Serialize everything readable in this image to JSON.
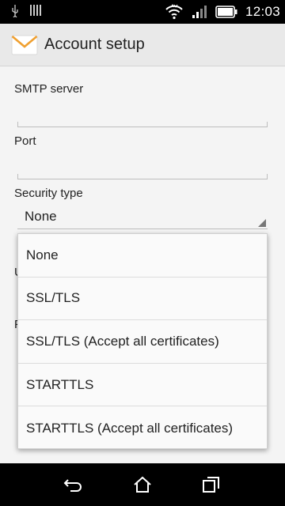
{
  "status_bar": {
    "time": "12:03",
    "icons": [
      "usb-icon",
      "sim-icon",
      "wifi-icon",
      "signal-icon",
      "battery-icon"
    ]
  },
  "action_bar": {
    "icon": "email-envelope-icon",
    "title": "Account setup"
  },
  "form": {
    "smtp_label": "SMTP server",
    "smtp_value": "",
    "port_label": "Port",
    "port_value": "",
    "security_label": "Security type",
    "security_value": "None",
    "hidden_label_1_peek": "U",
    "hidden_label_2_peek": "P"
  },
  "dropdown": {
    "options": [
      "None",
      "SSL/TLS",
      "SSL/TLS (Accept all certificates)",
      "STARTTLS",
      "STARTTLS (Accept all certificates)"
    ]
  },
  "nav_bar": {
    "icons": [
      "back-icon",
      "home-icon",
      "recents-icon"
    ]
  },
  "colors": {
    "status_bar_bg": "#000000",
    "action_bar_bg": "#e9e9e9",
    "form_bg": "#f4f4f4",
    "envelope_accent": "#f0a030"
  }
}
